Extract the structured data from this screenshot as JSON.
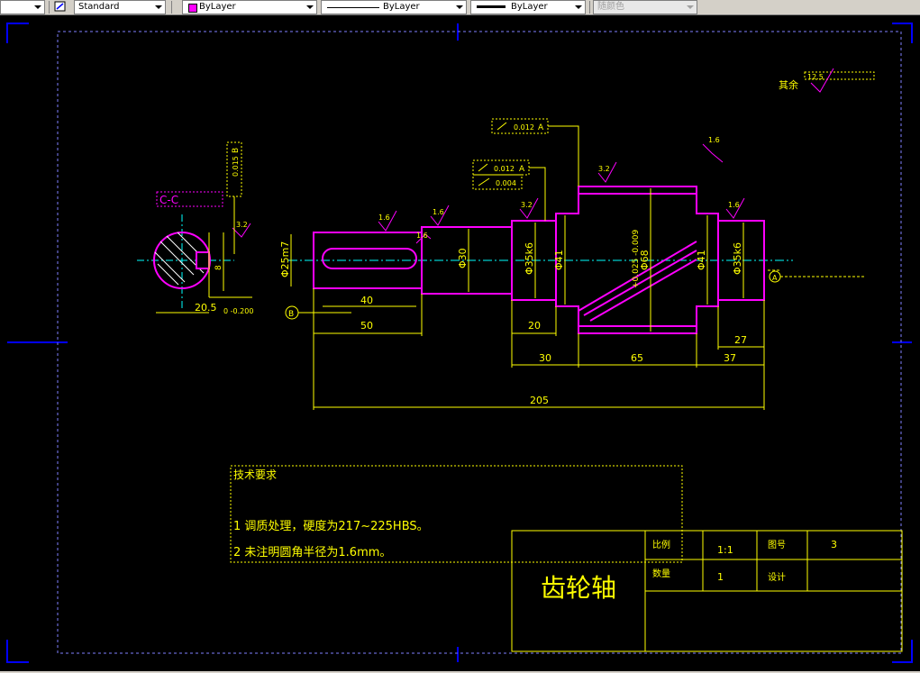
{
  "toolbar": {
    "text_style": "Standard",
    "layer_color": "ByLayer",
    "linetype": "ByLayer",
    "lineweight": "ByLayer",
    "plot_style": "随颜色"
  },
  "drawing": {
    "surface_roughness_rest": "其余",
    "roughness_rest_value": "12.5",
    "roughness_values": [
      "1.6",
      "1.6",
      "3.2",
      "3.2",
      "1.6",
      "1.6",
      "3.2",
      "1.6"
    ],
    "runout_tol": "0.012",
    "runout_datum": "A",
    "runout_tol2": "0.012",
    "runout_datum2": "A",
    "cyl_tol": "0.004",
    "sym_tol": "0.015",
    "sym_datum": "B",
    "datum_b": "B",
    "datum_a": "A",
    "dims": {
      "d25": "Φ25m7",
      "d30": "Φ30",
      "d35_left": "Φ35k6",
      "d41": "Φ41",
      "d68": "Φ68",
      "d68_tol": "+0.025 -0.009",
      "d41_right": "Φ41",
      "d35_right": "Φ35k6",
      "len50": "50",
      "key40": "40",
      "len20": "20",
      "len30": "30",
      "len65": "65",
      "len37": "37",
      "len27": "27",
      "len205": "205",
      "key_width": "8",
      "key_depth": "20.5",
      "key_depth_tol": "0 -0.200"
    },
    "tech_title": "技术要求",
    "tech_items": [
      "1  调质处理，硬度为217~225HBS。",
      "2  未注明圆角半径为1.6mm。"
    ],
    "title_block": {
      "part_name": "齿轮轴",
      "scale_label": "比例",
      "scale_value": "1:1",
      "drawing_no_label": "图号",
      "drawing_no_value": "3",
      "qty_label": "数量",
      "qty_value": "1",
      "design_label": "设计"
    }
  },
  "colors": {
    "frame": "#0000ff",
    "border": "#ff00ff",
    "outline": "#ff00ff",
    "dimension": "#ffff00",
    "centerline": "#00ffff"
  }
}
